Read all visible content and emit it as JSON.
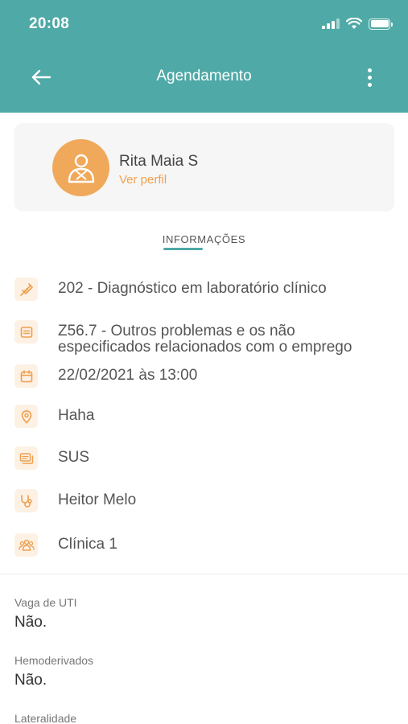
{
  "status_bar": {
    "time": "20:08"
  },
  "header": {
    "title": "Agendamento"
  },
  "colors": {
    "primary": "#4fa9a6",
    "accent": "#f0a95a"
  },
  "profile": {
    "name": "Rita Maia S",
    "link": "Ver perfil",
    "avatar_icon": "user-icon"
  },
  "tab": {
    "label": "INFORMAÇÕES"
  },
  "info": [
    {
      "icon": "syringe-icon",
      "text": "202 - Diagnóstico em laboratório clínico"
    },
    {
      "icon": "document-icon",
      "text": "Z56.7 - Outros problemas e os não\nespecificados relacionados com o emprego"
    },
    {
      "icon": "calendar-icon",
      "text": "22/02/2021 às 13:00"
    },
    {
      "icon": "location-pin-icon",
      "text": "Haha"
    },
    {
      "icon": "cards-icon",
      "text": "SUS"
    },
    {
      "icon": "stethoscope-icon",
      "text": "Heitor Melo"
    },
    {
      "icon": "group-icon",
      "text": "Clínica 1"
    }
  ],
  "fields": [
    {
      "label": "Vaga de UTI",
      "value": "Não."
    },
    {
      "label": "Hemoderivados",
      "value": "Não."
    },
    {
      "label": "Lateralidade"
    }
  ]
}
